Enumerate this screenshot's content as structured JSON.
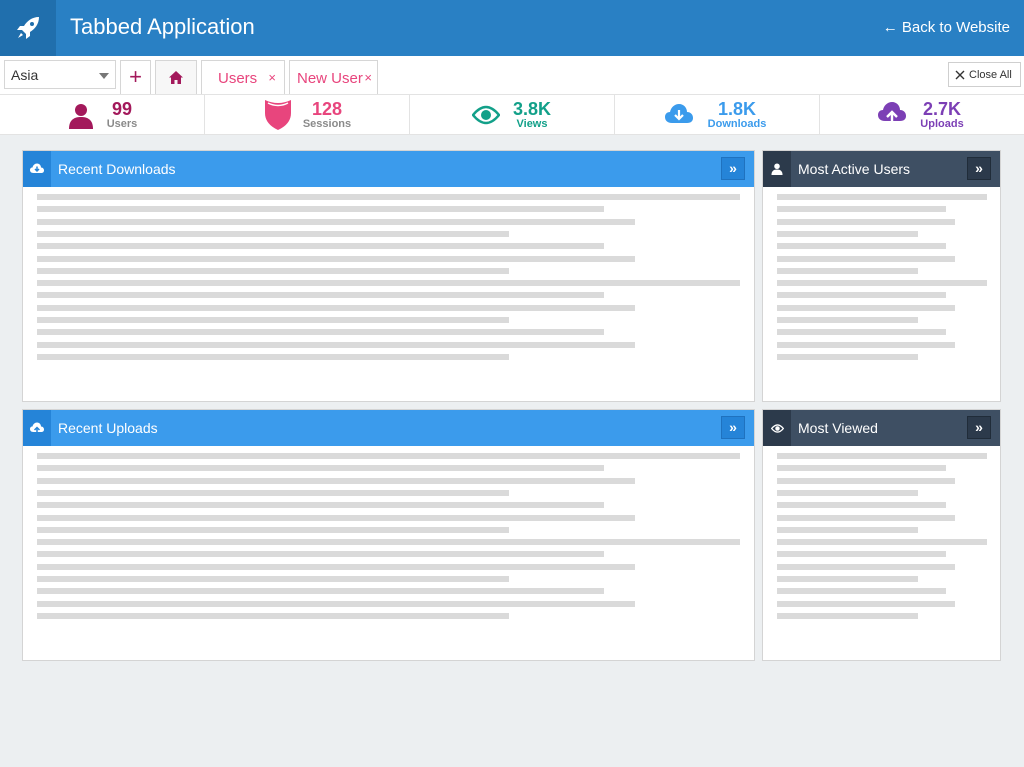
{
  "app": {
    "title": "Tabbed Application",
    "back_label": "← Back to Website",
    "icon": "rocket-icon"
  },
  "region": {
    "selected": "Asia"
  },
  "tabs": {
    "add_label": "+",
    "home_icon": "home-icon",
    "items": [
      {
        "label": "Users",
        "close": "×"
      },
      {
        "label": "New User",
        "close": "×"
      }
    ],
    "close_all_label": "Close All"
  },
  "stats": [
    {
      "value": "99",
      "label": "Users",
      "icon": "user-icon",
      "color": "#a3195b"
    },
    {
      "value": "128",
      "label": "Sessions",
      "icon": "shield-icon",
      "color": "#e8457d"
    },
    {
      "value": "3.8K",
      "label": "Views",
      "icon": "eye-icon",
      "color": "#12a089"
    },
    {
      "value": "1.8K",
      "label": "Downloads",
      "icon": "cloud-download-icon",
      "color": "#3b9bec"
    },
    {
      "value": "2.7K",
      "label": "Uploads",
      "icon": "cloud-upload-icon",
      "color": "#7c3fb5"
    }
  ],
  "panels": {
    "recent_downloads": {
      "title": "Recent Downloads",
      "icon": "cloud-download-icon",
      "action": "»"
    },
    "most_active_users": {
      "title": "Most Active Users",
      "icon": "user-icon",
      "action": "»"
    },
    "recent_uploads": {
      "title": "Recent Uploads",
      "icon": "cloud-upload-icon",
      "action": "»"
    },
    "most_viewed": {
      "title": "Most Viewed",
      "icon": "eye-icon",
      "action": "»"
    }
  },
  "colors": {
    "header": "#2980c4",
    "accent_pink": "#e8457d",
    "panel_blue": "#3b9bec",
    "panel_dark": "#3e4f63"
  }
}
